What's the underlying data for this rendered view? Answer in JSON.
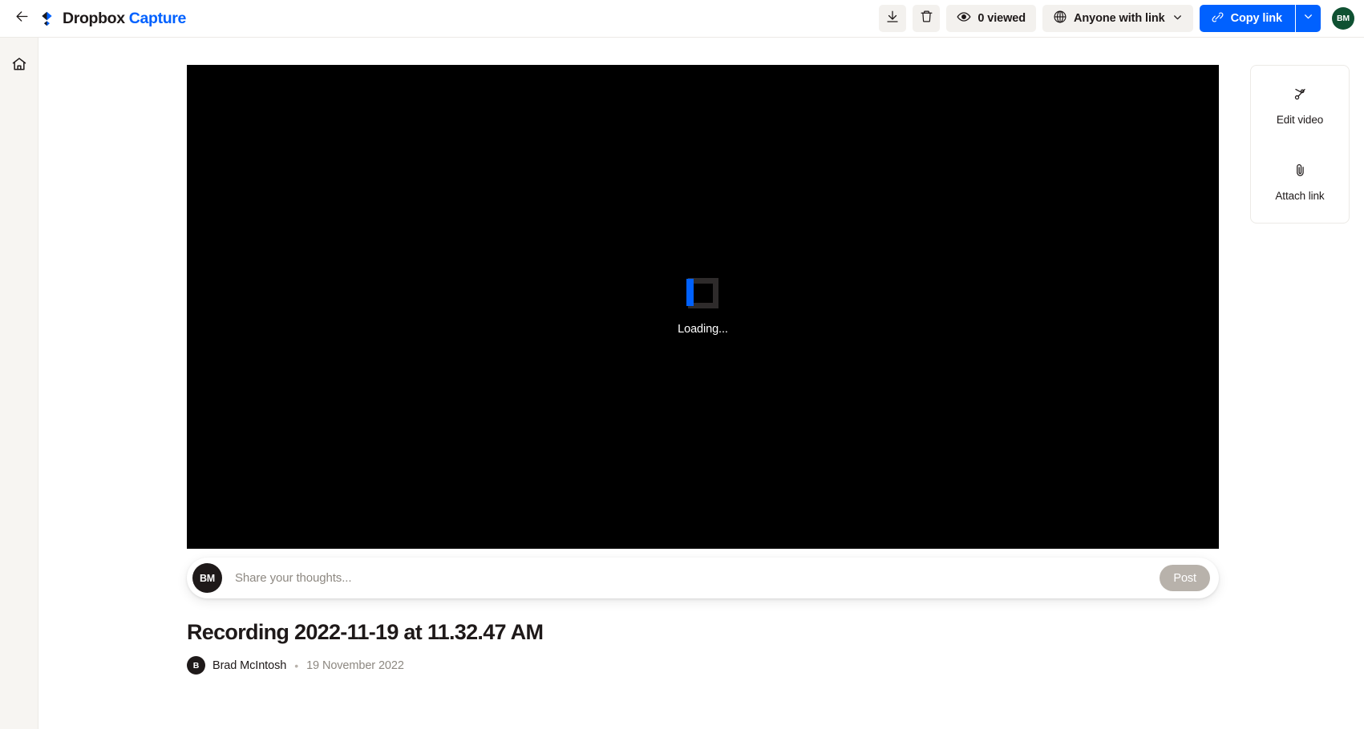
{
  "header": {
    "back_icon": "arrow-left-icon",
    "brand_logo_icon": "dropbox-logo-icon",
    "brand_name": "Dropbox",
    "brand_product": "Capture",
    "download_icon": "download-icon",
    "delete_icon": "trash-icon",
    "views_icon": "eye-icon",
    "views_label": "0 viewed",
    "share_icon": "globe-icon",
    "share_label": "Anyone with link",
    "share_caret_icon": "chevron-down-icon",
    "copy_icon": "link-icon",
    "copy_label": "Copy link",
    "copy_caret_icon": "chevron-down-icon",
    "account_initials": "BM"
  },
  "sidebar": {
    "items": [
      {
        "icon": "home-icon",
        "name": "home"
      }
    ]
  },
  "player": {
    "state": "loading",
    "loading_label": "Loading...",
    "spinner_icon": "square-spinner-icon"
  },
  "comment": {
    "avatar_initials": "BM",
    "placeholder": "Share your thoughts...",
    "value": "",
    "post_label": "Post",
    "post_enabled": false
  },
  "video": {
    "title": "Recording 2022-11-19 at 11.32.47 AM",
    "author_initial": "B",
    "author": "Brad McIntosh",
    "separator": "•",
    "date": "19 November 2022"
  },
  "actions": {
    "items": [
      {
        "icon": "scissors-icon",
        "label": "Edit video",
        "name": "edit-video"
      },
      {
        "icon": "paperclip-icon",
        "label": "Attach link",
        "name": "attach-link"
      }
    ]
  },
  "colors": {
    "brand_blue": "#0061ff",
    "text_primary": "#1e1919",
    "text_muted": "#8d8881",
    "surface": "#f3f1ee",
    "rail_bg": "#f7f5f2",
    "avatar_green": "#0f5132",
    "avatar_dark": "#1e1919",
    "post_disabled": "#b8b2ab"
  }
}
